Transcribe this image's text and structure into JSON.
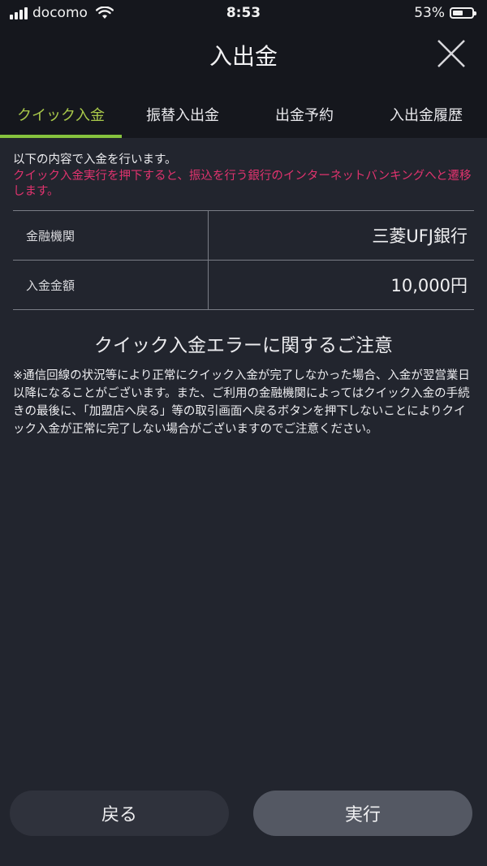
{
  "status_bar": {
    "carrier": "docomo",
    "time": "8:53",
    "battery": "53%",
    "battery_level": 0.53
  },
  "header": {
    "title": "入出金"
  },
  "tabs": [
    {
      "label": "クイック入金",
      "active": true
    },
    {
      "label": "振替入出金",
      "active": false
    },
    {
      "label": "出金予約",
      "active": false
    },
    {
      "label": "入出金履歴",
      "active": false
    }
  ],
  "content": {
    "intro": "以下の内容で入金を行います。",
    "warning": "クイック入金実行を押下すると、振込を行う銀行のインターネットバンキングへと遷移します。",
    "rows": [
      {
        "label": "金融機関",
        "value": "三菱UFJ銀行"
      },
      {
        "label": "入金金額",
        "value": "10,000円"
      }
    ],
    "notice_title": "クイック入金エラーに関するご注意",
    "notice_body": "※通信回線の状況等により正常にクイック入金が完了しなかった場合、入金が翌営業日以降になることがございます。また、ご利用の金融機関によってはクイック入金の手続きの最後に、「加盟店へ戻る」等の取引画面へ戻るボタンを押下しないことによりクイック入金が正常に完了しない場合がございますのでご注意ください。"
  },
  "buttons": {
    "back": "戻る",
    "execute": "実行"
  },
  "colors": {
    "background": "#22252e",
    "header_background": "#15171d",
    "active_tab": "#a9c94a",
    "warning_text": "#e0336e",
    "accent_underline": "#86c33e"
  }
}
